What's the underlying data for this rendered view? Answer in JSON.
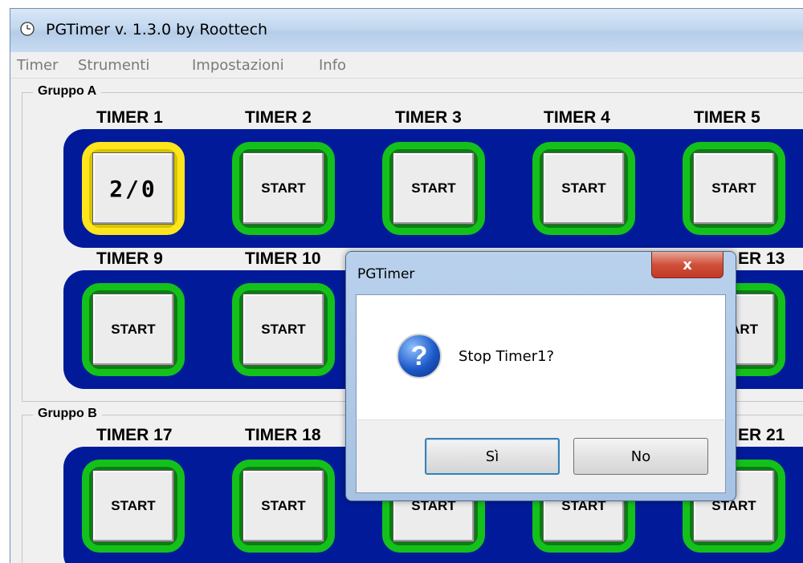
{
  "window": {
    "title": "PGTimer  v. 1.3.0  by Roottech"
  },
  "menu": [
    "Timer",
    "Strumenti",
    "Impostazioni",
    "Info"
  ],
  "groups": [
    {
      "label": "Gruppo A",
      "rows": [
        {
          "labels": [
            "TIMER  1",
            "TIMER  2",
            "TIMER  3",
            "TIMER  4",
            "TIMER  5"
          ],
          "buttons": [
            "2/0",
            "START",
            "START",
            "START",
            "START"
          ]
        },
        {
          "labels": [
            "TIMER  9",
            "TIMER 10",
            "ER 13"
          ],
          "buttons": [
            "START",
            "START",
            "ART"
          ]
        }
      ]
    },
    {
      "label": "Gruppo B",
      "rows": [
        {
          "labels": [
            "TIMER 17",
            "TIMER 18",
            "ER 21"
          ],
          "buttons": [
            "START",
            "START",
            "START",
            "START",
            "START"
          ]
        }
      ]
    }
  ],
  "dialog": {
    "title": "PGTimer",
    "close_label": "x",
    "message": "Stop Timer1?",
    "icon": "question-icon",
    "yes_label": "Sì",
    "no_label": "No"
  },
  "colors": {
    "band": "#001a9a",
    "button_ring": "#14c11b",
    "active_ring": "#ffe51c"
  }
}
